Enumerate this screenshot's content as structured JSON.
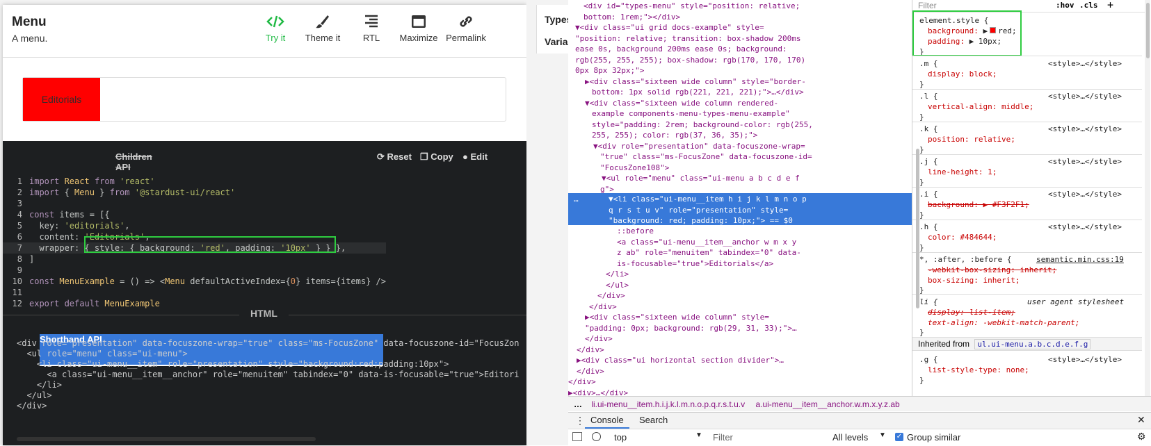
{
  "docs": {
    "title": "Menu",
    "subtitle": "A menu.",
    "toolbar": [
      {
        "label": "Try it",
        "icon": "code-icon",
        "active": true
      },
      {
        "label": "Theme it",
        "icon": "paint-brush-icon",
        "active": false
      },
      {
        "label": "RTL",
        "icon": "align-right-icon",
        "active": false
      },
      {
        "label": "Maximize",
        "icon": "window-maximize-icon",
        "active": false
      },
      {
        "label": "Permalink",
        "icon": "link-icon",
        "active": false
      }
    ],
    "example_item": "Editorials",
    "example_bg": "#ff0000",
    "code_tabs": {
      "shorthand": "Shorthand API",
      "children": "Children API"
    },
    "code_actions": {
      "reset": "Reset",
      "copy": "Copy",
      "edit": "Edit"
    },
    "code_lines": [
      "import React from 'react'",
      "import { Menu } from '@stardust-ui/react'",
      "",
      "const items = [{",
      "  key: 'editorials',",
      "  content: 'Editorials',",
      "  wrapper: { style: { background: 'red', padding: '10px' } },",
      "]",
      "",
      "const MenuExample = () => <Menu defaultActiveIndex={0} items={items} />",
      "",
      "export default MenuExample"
    ],
    "html_label": "HTML",
    "html_lines": [
      "<div role=\"presentation\" data-focuszone-wrap=\"true\" class=\"ms-FocusZone\" data-focuszone-id=\"FocusZon",
      "  <ul role=\"menu\" class=\"ui-menu\">",
      "    <li class=\"ui-menu__item\" role=\"presentation\" style=\"background:red;padding:10px\">",
      "      <a class=\"ui-menu__item__anchor\" role=\"menuitem\" tabindex=\"0\" data-is-focusable=\"true\">Editori",
      "    </li>",
      "  </ul>",
      "</div>"
    ]
  },
  "middle": {
    "line1": "Types",
    "line2": "Varia"
  },
  "devtools": {
    "elements_lines": [
      "<div id=\"types-menu\" style=\"position: relative;",
      "bottom: 1rem;\"></div>",
      "▼<div class=\"ui grid docs-example\" style=",
      "\"position: relative; transition: box-shadow 200ms",
      "ease 0s, background 200ms ease 0s; background:",
      "rgb(255, 255, 255); box-shadow: rgb(170, 170, 170)",
      "0px 8px 32px;\">",
      "▶<div class=\"sixteen wide column\" style=\"border-",
      "bottom: 1px solid rgb(221, 221, 221);\">…</div>",
      "▼<div class=\"sixteen wide column rendered-",
      "example components-menu-types-menu-example\"",
      "style=\"padding: 2rem; background-color: rgb(255,",
      "255, 255); color: rgb(37, 36, 35);\">",
      "▼<div role=\"presentation\" data-focuszone-wrap=",
      "\"true\" class=\"ms-FocusZone\" data-focuszone-id=",
      "\"FocusZone108\">",
      "▼<ul role=\"menu\" class=\"ui-menu a b c d e f",
      "g\">"
    ],
    "selected_lines": [
      "▼<li class=\"ui-menu__item h i j k l m n o p",
      "q r s t u v\" role=\"presentation\" style=",
      "\"background: red; padding: 10px;\"> == $0"
    ],
    "after_lines": [
      "::before",
      "<a class=\"ui-menu__item__anchor w m x y",
      "z ab\" role=\"menuitem\" tabindex=\"0\" data-",
      "is-focusable=\"true\">Editorials</a>",
      "</li>",
      "</ul>",
      "</div>",
      "</div>",
      "▶<div class=\"sixteen wide column\" style=",
      "\"padding: 0px; background: rgb(29, 31, 33);\">…",
      "</div>",
      "</div>",
      "▶<div class=\"ui horizontal section divider\">…",
      "</div>",
      "</div>",
      "▶<div>…</div>"
    ],
    "styles_filter": "Filter",
    "hov": ":hov",
    "cls": ".cls",
    "element_style": {
      "selector": "element.style {",
      "p1": "background: ",
      "v1": "red;",
      "p2": "padding: ",
      "v2": "10px;",
      "close": "}"
    },
    "rules": [
      {
        "sel": ".m {",
        "prop": "display: block;",
        "src": "<style>…</style>",
        "strike": false
      },
      {
        "sel": ".l {",
        "prop": "vertical-align: middle;",
        "src": "<style>…</style>",
        "strike": false
      },
      {
        "sel": ".k {",
        "prop": "position: relative;",
        "src": "<style>…</style>",
        "strike": false
      },
      {
        "sel": ".j {",
        "prop": "line-height: 1;",
        "src": "<style>…</style>",
        "strike": false
      },
      {
        "sel": ".i {",
        "prop": "background: ▶ #F3F2F1;",
        "src": "<style>…</style>",
        "strike": true
      },
      {
        "sel": ".h {",
        "prop": "color: #484644;",
        "src": "<style>…</style>",
        "strike": false
      }
    ],
    "universal": {
      "sel": "*, :after, :before {",
      "src": "semantic.min.css:19",
      "p1": "-webkit-box-sizing: inherit;",
      "p2": "box-sizing: inherit;"
    },
    "li_rule": {
      "sel": "li {",
      "src": "user agent stylesheet",
      "p1": "display: list-item;",
      "p2": "text-align: -webkit-match-parent;"
    },
    "inherited_label": "Inherited from",
    "inherited_from": "ul.ui-menu.a.b.c.d.e.f.g",
    "g_rule": {
      "sel": ".g {",
      "prop": "list-style-type: none;",
      "src": "<style>…</style>"
    },
    "breadcrumb": [
      "li.ui-menu__item.h.i.j.k.l.m.n.o.p.q.r.s.t.u.v",
      "a.ui-menu__item__anchor.w.m.x.y.z.ab"
    ],
    "drawer_tabs": {
      "console": "Console",
      "search": "Search"
    },
    "console": {
      "context": "top",
      "filter_placeholder": "Filter",
      "levels": "All levels",
      "group": "Group similar"
    }
  }
}
